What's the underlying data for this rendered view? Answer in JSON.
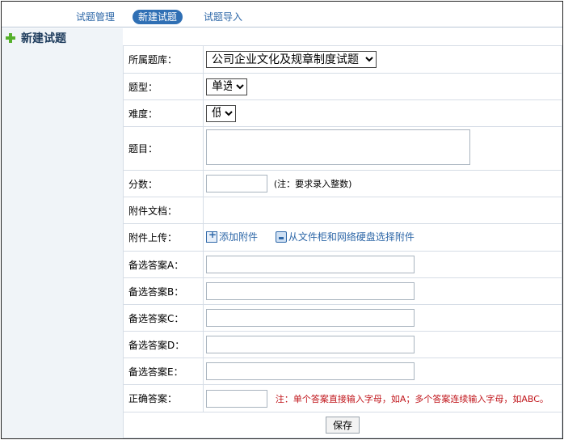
{
  "tabs": [
    {
      "label": "试题管理"
    },
    {
      "label": "新建试题"
    },
    {
      "label": "试题导入"
    }
  ],
  "page_title": "新建试题",
  "form": {
    "bank": {
      "label": "所属题库：",
      "value": "公司企业文化及规章制度试题"
    },
    "type": {
      "label": "题型：",
      "value": "单选"
    },
    "difficulty": {
      "label": "难度：",
      "value": "低"
    },
    "question": {
      "label": "题目：",
      "value": ""
    },
    "score": {
      "label": "分数：",
      "value": "",
      "note": "(注：要求录入整数)"
    },
    "attachment_docs": {
      "label": "附件文档："
    },
    "attachment_upload": {
      "label": "附件上传：",
      "add_label": "添加附件",
      "select_label": "从文件柜和网络硬盘选择附件"
    },
    "options": [
      {
        "label": "备选答案A：",
        "value": ""
      },
      {
        "label": "备选答案B：",
        "value": ""
      },
      {
        "label": "备选答案C：",
        "value": ""
      },
      {
        "label": "备选答案D：",
        "value": ""
      },
      {
        "label": "备选答案E：",
        "value": ""
      }
    ],
    "answer": {
      "label": "正确答案：",
      "value": "",
      "note": "注：单个答案直接输入字母，如A；多个答案连续输入字母，如ABC。"
    },
    "save_label": "保存"
  }
}
